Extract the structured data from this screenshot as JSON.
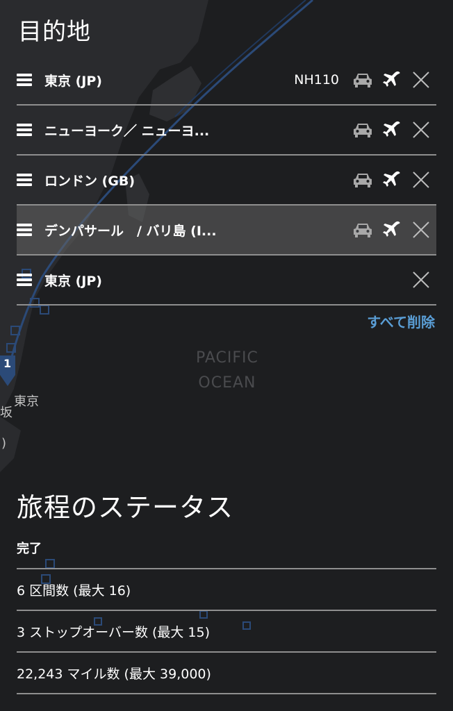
{
  "header": {
    "title": "目的地"
  },
  "destinations": [
    {
      "name": "東京 (JP)",
      "flight": "NH110",
      "car_icon": "car-icon",
      "plane_icon": "plane-icon",
      "remove_icon": "close-icon"
    },
    {
      "name": "ニューヨーク／ ニューヨ...",
      "flight": "",
      "car_icon": "car-icon",
      "plane_icon": "plane-icon",
      "remove_icon": "close-icon"
    },
    {
      "name": "ロンドン (GB)",
      "flight": "",
      "car_icon": "car-icon",
      "plane_icon": "plane-icon",
      "remove_icon": "close-icon"
    },
    {
      "name": "デンパサール　/ バリ島 (I...",
      "flight": "",
      "car_icon": "car-icon",
      "plane_icon": "plane-icon",
      "remove_icon": "close-icon",
      "selected": true
    },
    {
      "name": "東京 (JP)",
      "flight": "",
      "remove_icon": "close-icon"
    }
  ],
  "clear_all_label": "すべて削除",
  "map": {
    "ocean_label_line1": "PACIFIC",
    "ocean_label_line2": "OCEAN",
    "city_label": "東京",
    "partial_label_1": "坂",
    "partial_label_2": ")",
    "pin_number": "1"
  },
  "status": {
    "title": "旅程のステータス",
    "state": "完了",
    "rows": [
      "6 区間数 (最大 16)",
      "3 ストップオーバー数 (最大 15)",
      "22,243 マイル数 (最大 39,000)"
    ]
  },
  "colors": {
    "background": "#1d1e20",
    "accent_link": "#5a9ed6",
    "route_line": "#2b4a78",
    "divider": "#8f8f8f"
  }
}
